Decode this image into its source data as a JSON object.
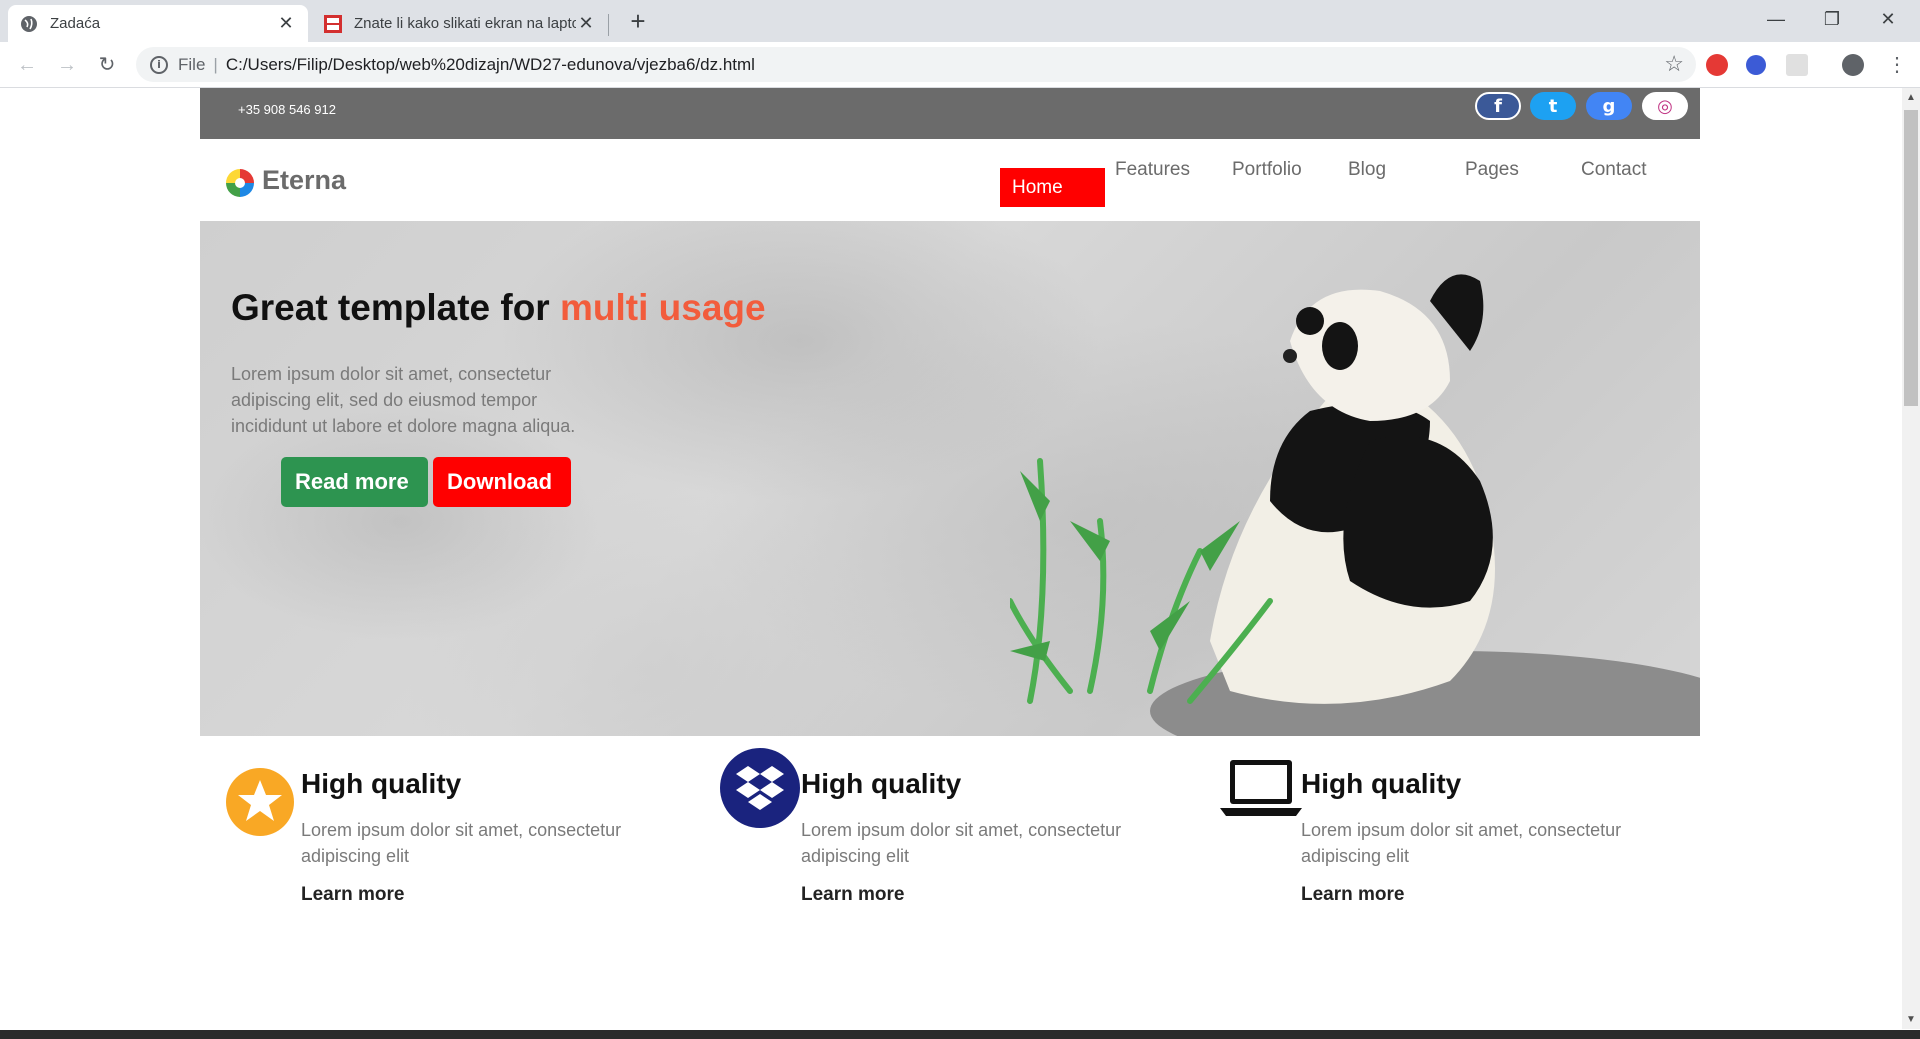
{
  "browser": {
    "tabs": [
      {
        "title": "Zadaća",
        "active": true
      },
      {
        "title": "Znate li kako slikati ekran na laptopu",
        "active": false
      }
    ],
    "new_tab": "+",
    "window_controls": {
      "minimize": "—",
      "restore": "❐",
      "close": "✕"
    },
    "address": {
      "scheme_label": "File",
      "url": "C:/Users/Filip/Desktop/web%20dizajn/WD27-edunova/vjezba6/dz.html"
    }
  },
  "topbar": {
    "phone": "+35 908 546 912",
    "social": [
      {
        "name": "facebook-icon",
        "glyph": "f",
        "color": "#3b5998"
      },
      {
        "name": "twitter-icon",
        "glyph": "t",
        "color": "#1da1f2"
      },
      {
        "name": "google-icon",
        "glyph": "g",
        "color": "#4285f4"
      },
      {
        "name": "instagram-icon",
        "glyph": "◎",
        "color": "#c13584"
      }
    ]
  },
  "header": {
    "brand": "Eterna",
    "nav": [
      "Home",
      "Features",
      "Portfolio",
      "Blog",
      "Pages",
      "Contact"
    ]
  },
  "hero": {
    "title_main": "Great template for ",
    "title_accent": "multi usage",
    "text": "Lorem ipsum dolor sit amet, consectetur adipiscing elit, sed do eiusmod tempor incididunt ut labore et dolore magna aliqua.",
    "read_more": "Read more",
    "download": "Download"
  },
  "features": [
    {
      "icon": "star-icon",
      "title": "High quality",
      "text": "Lorem ipsum dolor sit amet, consectetur adipiscing elit",
      "link": "Learn more"
    },
    {
      "icon": "dropbox-icon",
      "title": "High quality",
      "text": "Lorem ipsum dolor sit amet, consectetur adipiscing elit",
      "link": "Learn more"
    },
    {
      "icon": "laptop-icon",
      "title": "High quality",
      "text": "Lorem ipsum dolor sit amet, consectetur adipiscing elit",
      "link": "Learn more"
    }
  ]
}
